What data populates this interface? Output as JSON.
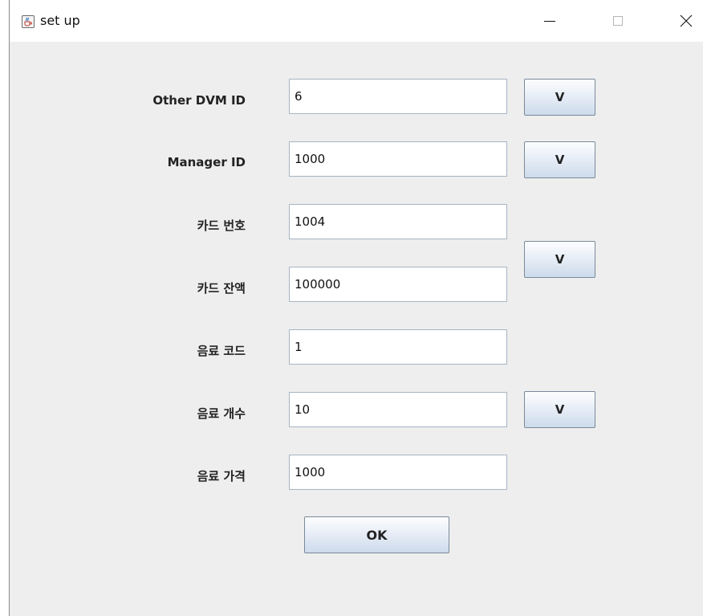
{
  "window": {
    "title": "set up",
    "controls": {
      "minimize_icon": "minimize-icon",
      "maximize_icon": "maximize-icon",
      "close_icon": "close-icon"
    },
    "app_icon": "java-coffee-cup-icon"
  },
  "form": {
    "fields": [
      {
        "label": "Other DVM ID",
        "value": "6"
      },
      {
        "label": "Manager ID",
        "value": "1000"
      },
      {
        "label": "카드 번호",
        "value": "1004"
      },
      {
        "label": "카드 잔액",
        "value": "100000"
      },
      {
        "label": "음료 코드",
        "value": "1"
      },
      {
        "label": "음료 개수",
        "value": "10"
      },
      {
        "label": "음료 가격",
        "value": "1000"
      }
    ],
    "verify_buttons": [
      "V",
      "V",
      "V",
      "V"
    ],
    "ok_label": "OK"
  },
  "colors": {
    "panel_bg": "#eeeeee",
    "titlebar_bg": "#ffffff",
    "button_gradient_top": "#fdfdff",
    "button_gradient_bottom": "#cddbeb",
    "input_border": "#a9b6c4"
  }
}
